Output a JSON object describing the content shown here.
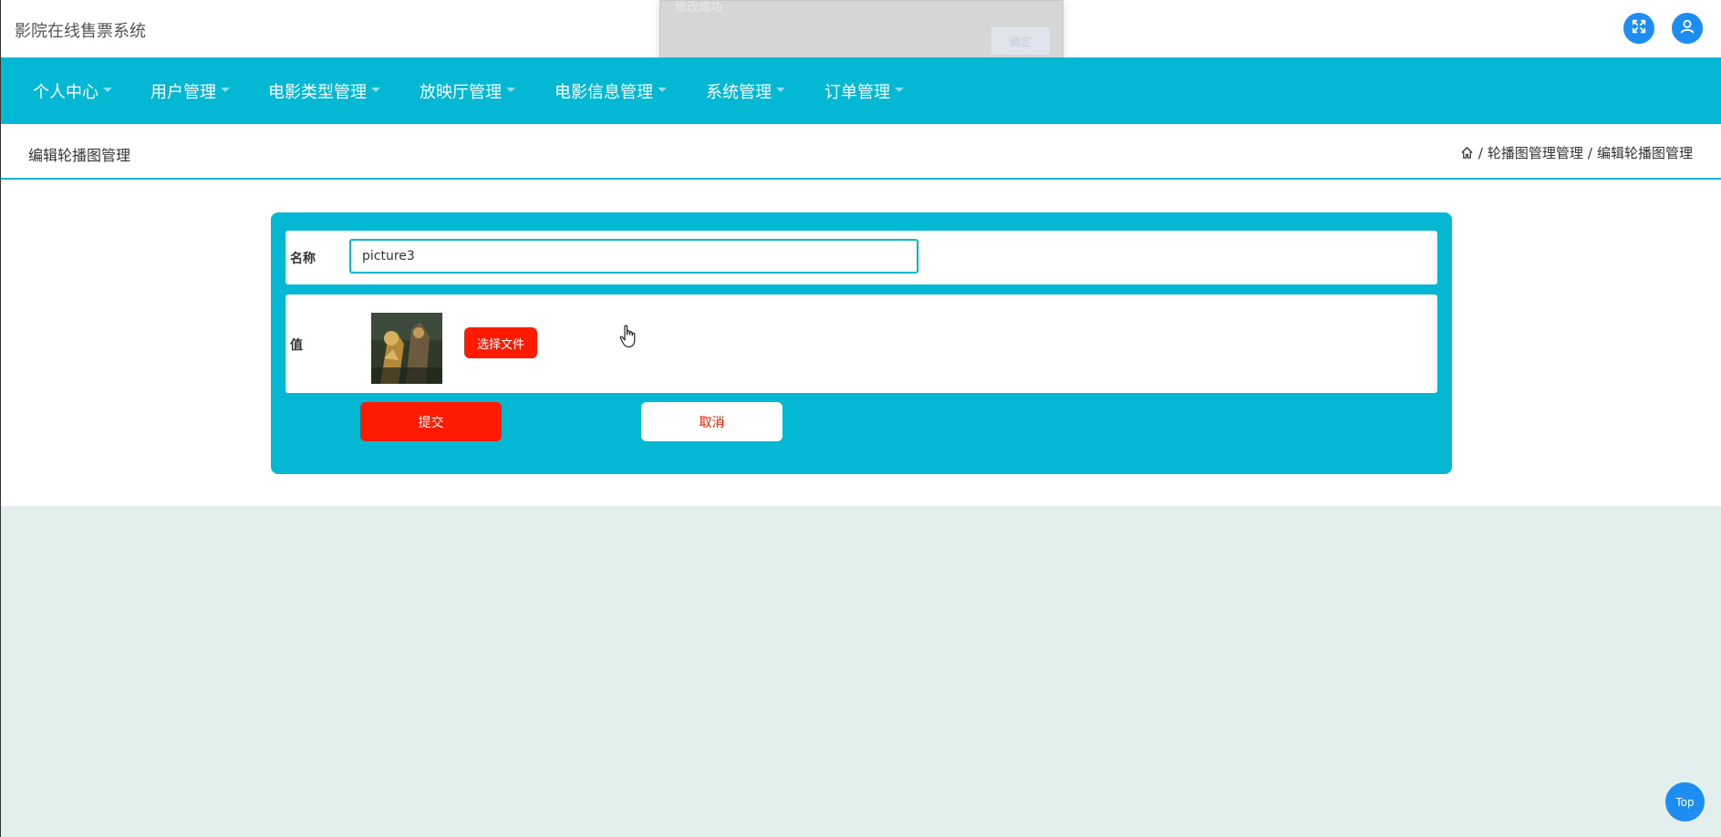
{
  "header": {
    "app_title": "影院在线售票系统",
    "fullscreen_icon": "expand-icon",
    "user_icon": "user-icon",
    "accent_color": "#1d8df2"
  },
  "toast": {
    "message": "修改成功",
    "ok_label": "确定"
  },
  "nav": {
    "background": "#04b8d4",
    "items": [
      {
        "label": "个人中心"
      },
      {
        "label": "用户管理"
      },
      {
        "label": "电影类型管理"
      },
      {
        "label": "放映厅管理"
      },
      {
        "label": "电影信息管理"
      },
      {
        "label": "系统管理"
      },
      {
        "label": "订单管理"
      }
    ]
  },
  "page": {
    "title": "编辑轮播图管理",
    "breadcrumb": {
      "home_icon": "home-icon",
      "separator": "/",
      "items": [
        "轮播图管理管理",
        "编辑轮播图管理"
      ]
    }
  },
  "form": {
    "name_label": "名称",
    "name_value": "picture3",
    "value_label": "值",
    "file_button": "选择文件",
    "submit_label": "提交",
    "cancel_label": "取消",
    "primary_color": "#ff1a00"
  },
  "floating": {
    "top_label": "Top"
  }
}
